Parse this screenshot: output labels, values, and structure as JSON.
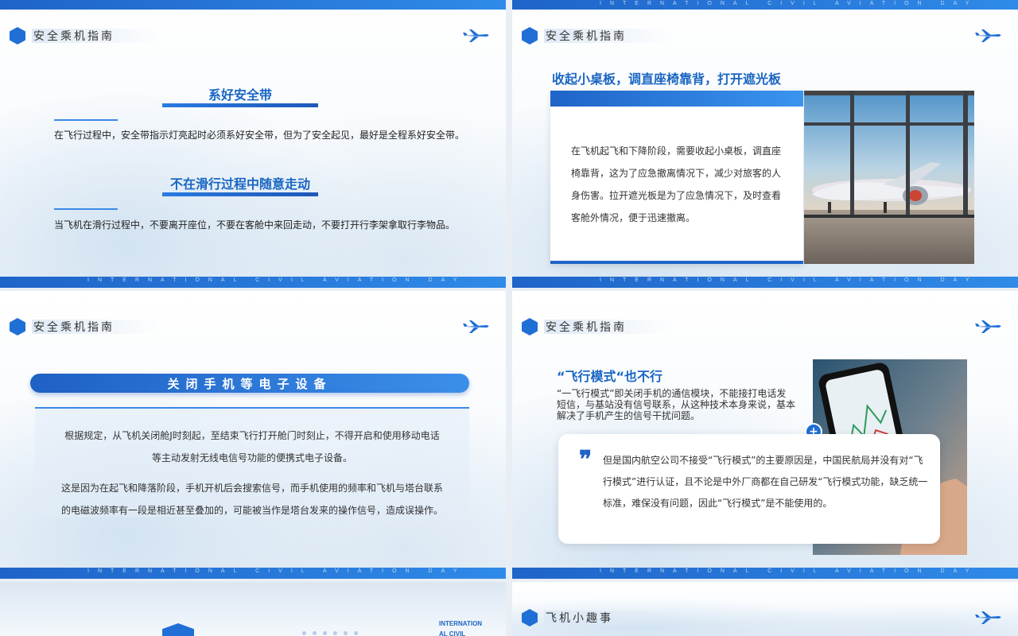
{
  "common": {
    "banner_text": "INTERNATIONAL CIVIL AVIATION DAY",
    "section_title": "安全乘机指南",
    "accent_color": "#1f6fd6"
  },
  "slide1": {
    "heading1": "系好安全带",
    "text1": "在飞行过程中，安全带指示灯亮起时必须系好安全带，但为了安全起见，最好是全程系好安全带。",
    "heading2": "不在滑行过程中随意走动",
    "text2": "当飞机在滑行过程中，不要离开座位，不要在客舱中来回走动，不要打开行李架拿取行李物品。"
  },
  "slide2": {
    "heading": "收起小桌板，调直座椅靠背，打开遮光板",
    "text": "在飞机起飞和下降阶段，需要收起小桌板，调直座椅靠背，这为了应急撤离情况下，减少对旅客的人身伤害。拉开遮光板是为了应急情况下，及时查看客舱外情况，便于迅速撤离。"
  },
  "slide3": {
    "heading": "关闭手机等电子设备",
    "para1_line1": "根据规定，从飞机关闭舱J时刻起，至结束飞行打开舱门时刻止，不得开启和使用移动电话",
    "para1_line2": "等主动发射无线电信号功能的便携式电子设备。",
    "para2_line1": "这是因为在起飞和降落阶段，手机开机后会搜索信号，而手机使用的频率和飞机与塔台联系",
    "para2_line2": "的电磁波频率有一段是相近甚至叠加的，可能被当作是塔台发来的操作信号，造成误操作。"
  },
  "slide4": {
    "heading": "“飞行模式“也不行",
    "subtext": "“一飞行模式”即关闭手机的通信模块，不能接打电话发短信，与基站没有信号联系，从这种技术本身来说，基本解决了手机产生的信号干扰问题。",
    "quote_text": "但是国内航空公司不接受“飞行模式”的主要原因是，中国民航局并没有对“飞行模式”进行认证，且不论是中外厂商都在自己研发“飞行模式功能，缺乏统一标准，难保没有问题，因此“飞行模式”是不能使用的。"
  },
  "slide5": {
    "corner_text_line1": "INTERNATION",
    "corner_text_line2": "AL CIVIL"
  },
  "slide6": {
    "section_title": "飞机小趣事"
  }
}
